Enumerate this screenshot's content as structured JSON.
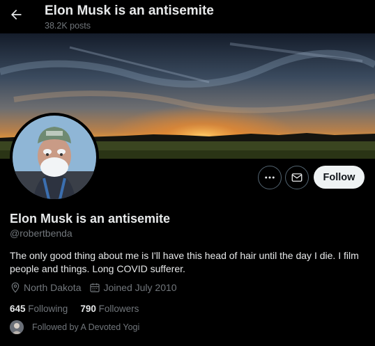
{
  "header": {
    "title": "Elon Musk is an antisemite",
    "post_count": "38.2K posts",
    "back_icon": "arrow-left-icon"
  },
  "actions": {
    "more_icon": "more-dots-icon",
    "message_icon": "envelope-icon",
    "follow_label": "Follow"
  },
  "profile": {
    "display_name": "Elon Musk is an antisemite",
    "handle": "@robertbenda",
    "bio": "The only good thing about me is I'll have this head of hair until the day I die. I film people and things. Long COVID sufferer.",
    "location": "North Dakota",
    "joined": "Joined July 2010"
  },
  "stats": {
    "following_count": "645",
    "following_label": "Following",
    "followers_count": "790",
    "followers_label": "Followers"
  },
  "followed_by": {
    "text": "Followed by A Devoted Yogi"
  },
  "colors": {
    "background": "#000000",
    "text_primary": "#e7e9ea",
    "text_secondary": "#71767b",
    "follow_button_bg": "#eff3f4",
    "follow_button_text": "#0f1419",
    "border": "#536471"
  }
}
